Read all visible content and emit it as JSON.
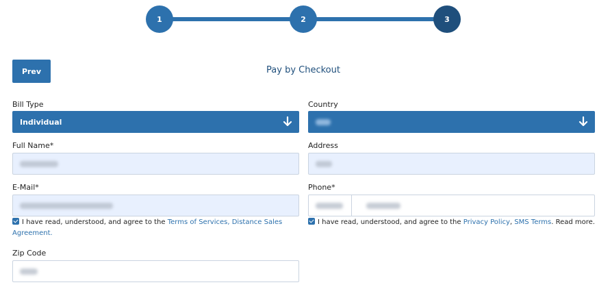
{
  "stepper": {
    "steps": [
      "1",
      "2",
      "3"
    ],
    "current_step": 3
  },
  "header": {
    "prev_label": "Prev",
    "title": "Pay by Checkout"
  },
  "form": {
    "bill_type": {
      "label": "Bill Type",
      "value": "Individual"
    },
    "country": {
      "label": "Country",
      "value": ""
    },
    "full_name": {
      "label": "Full Name*",
      "value": ""
    },
    "address": {
      "label": "Address",
      "value": ""
    },
    "email": {
      "label": "E-Mail*",
      "value": ""
    },
    "phone": {
      "label": "Phone*",
      "code": "",
      "number": ""
    },
    "zip": {
      "label": "Zip Code",
      "value": ""
    }
  },
  "agreements": {
    "left": {
      "checked": true,
      "text": "I have read, understood, and agree to the",
      "link1": "Terms of Services,",
      "link2": "Distance Sales Agreement."
    },
    "right": {
      "checked": true,
      "text": "I have read, understood, and agree to the",
      "link1": "Privacy Policy",
      "separator": ",",
      "link2": "SMS Terms",
      "suffix": ". Read more."
    }
  },
  "colors": {
    "primary": "#2d71ad",
    "step_current": "#1f4f7c",
    "input_filled": "#e8f0fe"
  },
  "icons": {
    "select_arrow": "arrow-down-icon"
  }
}
